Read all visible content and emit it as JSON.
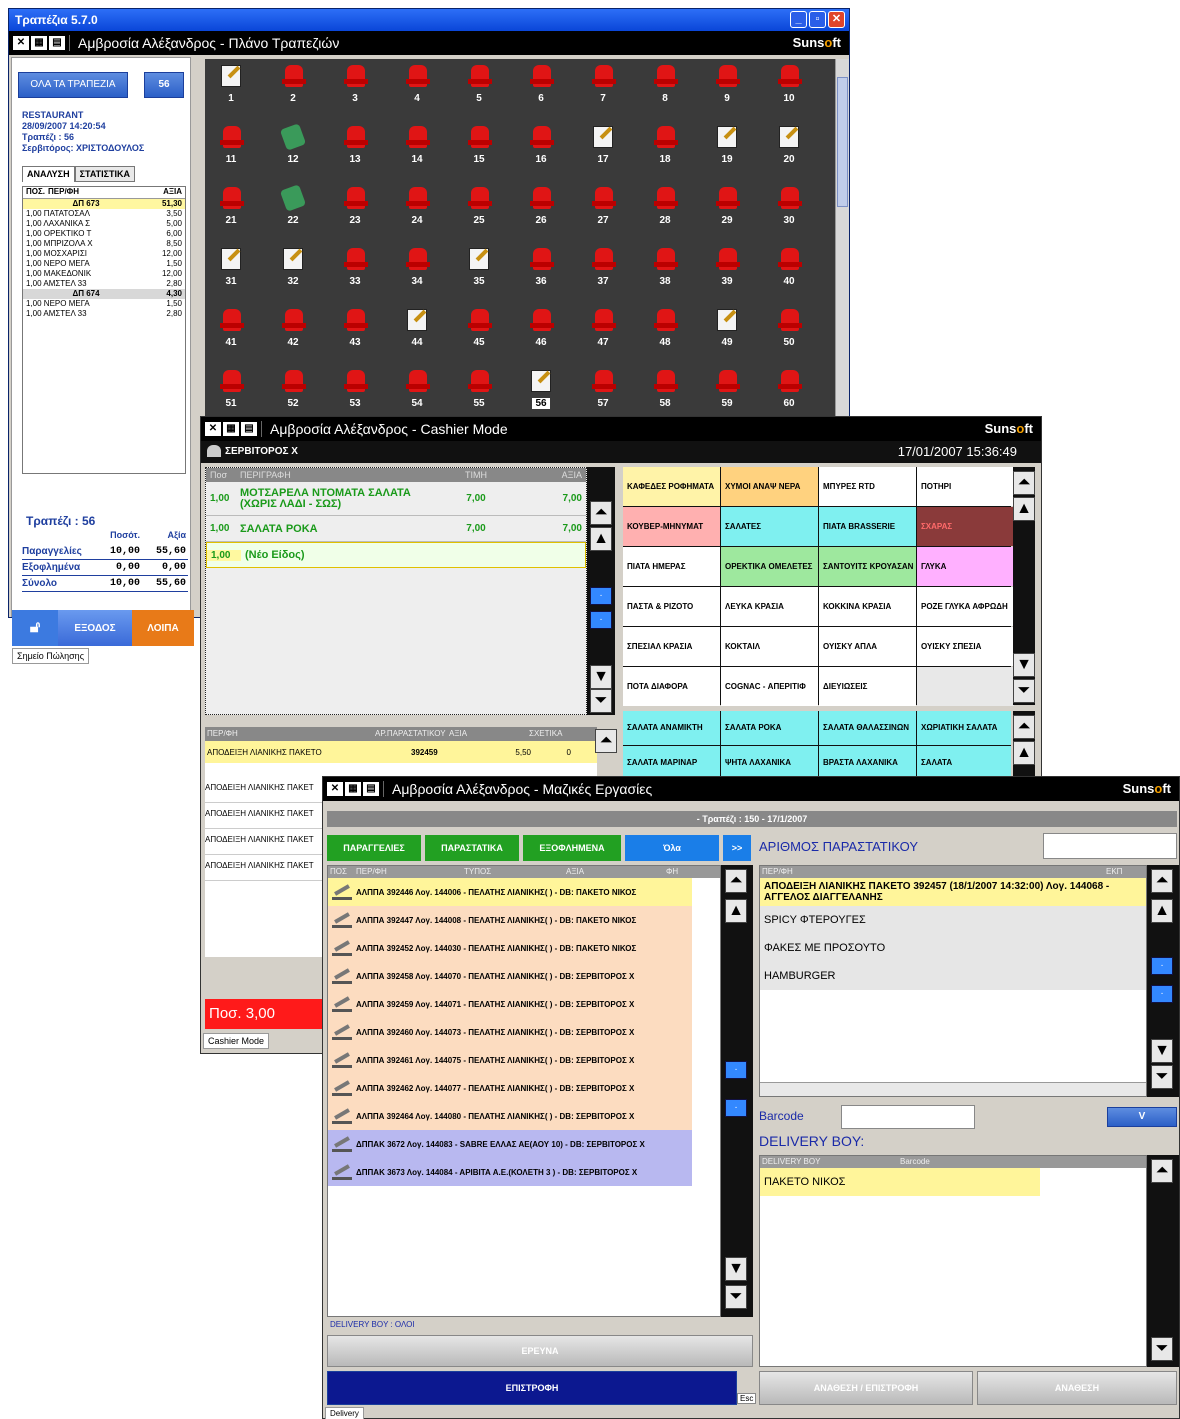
{
  "win1": {
    "titlebar": "Τραπέζια 5.7.0",
    "app_title": "Αμβροσία Αλέξανδρος - Πλάνο Τραπεζιών",
    "brand": "Sunsoft",
    "all_tables_btn": "ΟΛΑ ΤΑ ΤΡΑΠΕΖΙΑ",
    "count_btn": "56",
    "info": [
      "RESTAURANT",
      "28/09/2007   14:20:54",
      "Τραπέζι : 56",
      "Σερβιτόρος: ΧΡΙΣΤΟΔΟΥΛΟΣ"
    ],
    "tabs": [
      "ΑΝΑΛΥΣΗ",
      "ΣΤΑΤΙΣΤΙΚΑ"
    ],
    "detail_header": [
      "ΠΟΣ.",
      "ΠΕΡ/ΦΗ",
      "ΑΞΙΑ"
    ],
    "detail_rows": [
      {
        "type": "grp",
        "label": "ΔΠ 673",
        "value": "51,30"
      },
      {
        "label": "1,00 ΠΑΤΑΤΟΣΑΛ",
        "value": "3,50"
      },
      {
        "label": "1,00 ΛΑΧΑΝΙΚΑ Σ",
        "value": "5,00"
      },
      {
        "label": "1,00 ΟΡΕΚΤΙΚΟ Τ",
        "value": "6,00"
      },
      {
        "label": "1,00 ΜΠΡΙΖΟΛΑ Χ",
        "value": "8,50"
      },
      {
        "label": "1,00 ΜΟΣΧΑΡΙΣΙ",
        "value": "12,00"
      },
      {
        "label": "1,00 ΝΕΡΟ ΜΕΓΑ",
        "value": "1,50"
      },
      {
        "label": "1,00 ΜΑΚΕΔΟΝΙΚ",
        "value": "12,00"
      },
      {
        "label": "1,00 ΑΜΣΤΕΛ 33",
        "value": "2,80"
      },
      {
        "type": "grp2",
        "label": "ΔΠ 674",
        "value": "4,30"
      },
      {
        "label": "1,00 ΝΕΡΟ ΜΕΓΑ",
        "value": "1,50"
      },
      {
        "label": "1,00 ΑΜΣΤΕΛ 33",
        "value": "2,80"
      }
    ],
    "totals_title": "Τραπέζι : 56",
    "totals_header": [
      "Ποσότ.",
      "Αξία"
    ],
    "totals": [
      {
        "label": "Παραγγελίες",
        "qty": "10,00",
        "value": "55,60"
      },
      {
        "label": "Εξοφλημένα",
        "qty": "0,00",
        "value": "0,00"
      },
      {
        "label": "Σύνολο",
        "qty": "10,00",
        "value": "55,60"
      }
    ],
    "exit_btn": "ΕΞΟΔΟΣ",
    "other_btn": "ΛΟΙΠΑ",
    "status": "Σημείο Πώλησης",
    "tables": [
      {
        "n": "1",
        "s": "note"
      },
      {
        "n": "2",
        "s": "free"
      },
      {
        "n": "3",
        "s": "free"
      },
      {
        "n": "4",
        "s": "free"
      },
      {
        "n": "5",
        "s": "free"
      },
      {
        "n": "6",
        "s": "free"
      },
      {
        "n": "7",
        "s": "free"
      },
      {
        "n": "8",
        "s": "free"
      },
      {
        "n": "9",
        "s": "free"
      },
      {
        "n": "10",
        "s": "free"
      },
      {
        "n": "11",
        "s": "free"
      },
      {
        "n": "12",
        "s": "money"
      },
      {
        "n": "13",
        "s": "free"
      },
      {
        "n": "14",
        "s": "free"
      },
      {
        "n": "15",
        "s": "free"
      },
      {
        "n": "16",
        "s": "free"
      },
      {
        "n": "17",
        "s": "note"
      },
      {
        "n": "18",
        "s": "free"
      },
      {
        "n": "19",
        "s": "note"
      },
      {
        "n": "20",
        "s": "note"
      },
      {
        "n": "21",
        "s": "free"
      },
      {
        "n": "22",
        "s": "money"
      },
      {
        "n": "23",
        "s": "free"
      },
      {
        "n": "24",
        "s": "free"
      },
      {
        "n": "25",
        "s": "free"
      },
      {
        "n": "26",
        "s": "free"
      },
      {
        "n": "27",
        "s": "free"
      },
      {
        "n": "28",
        "s": "free"
      },
      {
        "n": "29",
        "s": "free"
      },
      {
        "n": "30",
        "s": "free"
      },
      {
        "n": "31",
        "s": "note"
      },
      {
        "n": "32",
        "s": "note"
      },
      {
        "n": "33",
        "s": "free"
      },
      {
        "n": "34",
        "s": "free"
      },
      {
        "n": "35",
        "s": "note"
      },
      {
        "n": "36",
        "s": "free"
      },
      {
        "n": "37",
        "s": "free"
      },
      {
        "n": "38",
        "s": "free"
      },
      {
        "n": "39",
        "s": "free"
      },
      {
        "n": "40",
        "s": "free"
      },
      {
        "n": "41",
        "s": "free"
      },
      {
        "n": "42",
        "s": "free"
      },
      {
        "n": "43",
        "s": "free"
      },
      {
        "n": "44",
        "s": "note"
      },
      {
        "n": "45",
        "s": "free"
      },
      {
        "n": "46",
        "s": "free"
      },
      {
        "n": "47",
        "s": "free"
      },
      {
        "n": "48",
        "s": "free"
      },
      {
        "n": "49",
        "s": "note"
      },
      {
        "n": "50",
        "s": "free"
      },
      {
        "n": "51",
        "s": "free"
      },
      {
        "n": "52",
        "s": "free"
      },
      {
        "n": "53",
        "s": "free"
      },
      {
        "n": "54",
        "s": "free"
      },
      {
        "n": "55",
        "s": "free"
      },
      {
        "n": "56",
        "s": "note-selected"
      },
      {
        "n": "57",
        "s": "free"
      },
      {
        "n": "58",
        "s": "free"
      },
      {
        "n": "59",
        "s": "free"
      },
      {
        "n": "60",
        "s": "free"
      }
    ]
  },
  "win2": {
    "app_title": "Αμβροσία Αλέξανδρος - Cashier Mode",
    "waiter": "ΣΕΡΒΙΤΟΡΟΣ Χ",
    "datetime": "17/01/2007   15:36:49",
    "order_header": [
      "Ποσ",
      "ΠΕΡΙΓΡΑΦΗ",
      "ΤΙΜΗ",
      "ΑΞΙΑ"
    ],
    "order_rows": [
      {
        "qty": "1,00",
        "desc": "ΜΟΤΣΑΡΕΛΑ ΝΤΟΜΑΤΑ ΣΑΛΑΤΑ (ΧΩΡΙΣ ΛΑΔΙ - ΣΩΣ)",
        "price": "7,00",
        "value": "7,00"
      },
      {
        "qty": "1,00",
        "desc": "ΣΑΛΑΤΑ ΡΟΚΑ",
        "price": "7,00",
        "value": "7,00"
      },
      {
        "qty": "1,00",
        "desc": "(Νέο Είδος)",
        "price": "",
        "value": ""
      }
    ],
    "categories": [
      {
        "label": "ΚΑΦΕΔΕΣ ΡΟΦΗΜΑΤΑ",
        "color": "#fff3a8"
      },
      {
        "label": "ΧΥΜΟΙ ΑΝΑΨ ΝΕΡΑ",
        "color": "#ffd27f"
      },
      {
        "label": "ΜΠΥΡΕΣ RTD",
        "color": "#ffffff"
      },
      {
        "label": "ΠΟΤΗΡΙ",
        "color": "#ffffff"
      },
      {
        "label": "ΚΟΥΒΕΡ-ΜΗΝΥΜΑΤ",
        "color": "#ffb0b0"
      },
      {
        "label": "ΣΑΛΑΤΕΣ",
        "color": "#7ff0f0"
      },
      {
        "label": "ΠΙΑΤΑ BRASSERIE",
        "color": "#7ff0f0"
      },
      {
        "label": "ΣΧΑΡΑΣ",
        "color": "#8a3a3a"
      },
      {
        "label": "ΠΙΑΤΑ ΗΜΕΡΑΣ",
        "color": "#ffffff"
      },
      {
        "label": "ΟΡΕΚΤΙΚΑ ΟΜΕΛΕΤΕΣ",
        "color": "#9ee89e"
      },
      {
        "label": "ΣΑΝΤΟΥΙΤΣ ΚΡΟΥΑΣΑΝ",
        "color": "#9ee89e"
      },
      {
        "label": "ΓΛΥΚΑ",
        "color": "#ffb0ff"
      },
      {
        "label": "ΠΑΣΤΑ & ΡΙΖΟΤΟ",
        "color": "#ffffff"
      },
      {
        "label": "ΛΕΥΚΑ ΚΡΑΣΙΑ",
        "color": "#ffffff"
      },
      {
        "label": "ΚΟΚΚΙΝΑ ΚΡΑΣΙΑ",
        "color": "#ffffff"
      },
      {
        "label": "ΡΟΖΕ ΓΛΥΚΑ ΑΦΡΩΔΗ",
        "color": "#ffffff"
      },
      {
        "label": "ΣΠΕΣΙΑΛ ΚΡΑΣΙΑ",
        "color": "#ffffff"
      },
      {
        "label": "ΚΟΚΤΑΙΛ",
        "color": "#ffffff"
      },
      {
        "label": "ΟΥΙΣΚΥ ΑΠΛΑ",
        "color": "#ffffff"
      },
      {
        "label": "ΟΥΙΣΚΥ ΣΠΕΣΙΑ",
        "color": "#ffffff"
      },
      {
        "label": "ΠΟΤΑ ΔΙΑΦΟΡΑ",
        "color": "#ffffff"
      },
      {
        "label": "COGNAC - ΑΠΕΡΙΤΙΦ",
        "color": "#ffffff"
      },
      {
        "label": "ΔΙΕΥΙΩΣΕΙΣ",
        "color": "#ffffff"
      },
      {
        "label": "",
        "color": "#e8e8e8"
      }
    ],
    "products": [
      {
        "label": "ΣΑΛΑΤΑ ΑΝΑΜΙΚΤΗ"
      },
      {
        "label": "ΣΑΛΑΤΑ ΡΟΚΑ"
      },
      {
        "label": "ΣΑΛΑΤΑ ΘΑΛΑΣΣΙΝΩΝ"
      },
      {
        "label": "ΧΩΡΙΑΤΙΚΗ ΣΑΛΑΤΑ"
      },
      {
        "label": "ΣΑΛΑΤΑ ΜΑΡΙΝΑΡ"
      },
      {
        "label": "ΨΗΤΑ ΛΑΧΑΝΙΚΑ"
      },
      {
        "label": "ΒΡΑΣΤΑ ΛΑΧΑΝΙΚΑ"
      },
      {
        "label": "ΣΑΛΑΤΑ"
      }
    ],
    "doc_header": [
      "ΠΕΡ/ΦΗ",
      "ΑΡ.ΠΑΡΑΣΤΑΤΙΚΟΥ",
      "ΑΞΙΑ",
      "ΣΧΕΤΙΚΑ"
    ],
    "doc_row": {
      "desc": "ΑΠΟΔΕΙΞΗ ΛΙΑΝΙΚΗΣ ΠΑΚΕΤΟ",
      "num": "392459",
      "value": "5,50",
      "rel": "0"
    },
    "doc_rest": [
      "ΑΠΟΔΕΙΞΗ ΛΙΑΝΙΚΗΣ ΠΑΚΕΤ",
      "ΑΠΟΔΕΙΞΗ ΛΙΑΝΙΚΗΣ ΠΑΚΕΤ",
      "ΑΠΟΔΕΙΞΗ ΛΙΑΝΙΚΗΣ ΠΑΚΕΤ",
      "ΑΠΟΔΕΙΞΗ ΛΙΑΝΙΚΗΣ ΠΑΚΕΤ"
    ],
    "qty_label": "Ποσ.  3,00",
    "status": "Cashier Mode"
  },
  "win3": {
    "app_title": "Αμβροσία Αλέξανδρος - Μαζικές Εργασίες",
    "info": "- Τραπέζι : 150  -  17/1/2007",
    "tabs": [
      {
        "label": "ΠΑΡΑΓΓΕΛΙΕΣ",
        "color": "#22a022"
      },
      {
        "label": "ΠΑΡΑΣΤΑΤΙΚΑ",
        "color": "#22a022"
      },
      {
        "label": "ΕΞΟΦΛΗΜΕΝΑ",
        "color": "#22a022"
      },
      {
        "label": "Όλα",
        "color": "#1a7ee8"
      }
    ],
    "more_btn": ">>",
    "list_header": [
      "ΠΟΣ",
      "ΠΕΡ/ΦΗ",
      "ΤΥΠΟΣ",
      "ΑΞΙΑ",
      "ΦΗ"
    ],
    "list_items": [
      {
        "text": "ΑΛΠΠΑ 392446 Λογ. 144006 - ΠΕΛΑΤΗΣ ΛΙΑΝΙΚΗΣ( ) - DB: ΠΑΚΕΤΟ ΝΙΚΟΣ",
        "color": "#fff59a"
      },
      {
        "text": "ΑΛΠΠΑ 392447 Λογ. 144008 - ΠΕΛΑΤΗΣ ΛΙΑΝΙΚΗΣ( ) - DB: ΠΑΚΕΤΟ ΝΙΚΟΣ",
        "color": "#fcdcc0"
      },
      {
        "text": "ΑΛΠΠΑ 392452 Λογ. 144030 - ΠΕΛΑΤΗΣ ΛΙΑΝΙΚΗΣ( ) - DB: ΠΑΚΕΤΟ ΝΙΚΟΣ",
        "color": "#fcdcc0"
      },
      {
        "text": "ΑΛΠΠΑ 392458 Λογ. 144070 - ΠΕΛΑΤΗΣ ΛΙΑΝΙΚΗΣ( ) - DB: ΣΕΡΒΙΤΟΡΟΣ Χ",
        "color": "#fcdcc0"
      },
      {
        "text": "ΑΛΠΠΑ 392459 Λογ. 144071 - ΠΕΛΑΤΗΣ ΛΙΑΝΙΚΗΣ( ) - DB: ΣΕΡΒΙΤΟΡΟΣ Χ",
        "color": "#fcdcc0"
      },
      {
        "text": "ΑΛΠΠΑ 392460 Λογ. 144073 - ΠΕΛΑΤΗΣ ΛΙΑΝΙΚΗΣ( ) - DB: ΣΕΡΒΙΤΟΡΟΣ Χ",
        "color": "#fcdcc0"
      },
      {
        "text": "ΑΛΠΠΑ 392461 Λογ. 144075 - ΠΕΛΑΤΗΣ ΛΙΑΝΙΚΗΣ( ) - DB: ΣΕΡΒΙΤΟΡΟΣ Χ",
        "color": "#fcdcc0"
      },
      {
        "text": "ΑΛΠΠΑ 392462 Λογ. 144077 - ΠΕΛΑΤΗΣ ΛΙΑΝΙΚΗΣ( ) - DB: ΣΕΡΒΙΤΟΡΟΣ Χ",
        "color": "#fcdcc0"
      },
      {
        "text": "ΑΛΠΠΑ 392464 Λογ. 144080 - ΠΕΛΑΤΗΣ ΛΙΑΝΙΚΗΣ( ) - DB: ΣΕΡΒΙΤΟΡΟΣ Χ",
        "color": "#fcdcc0"
      },
      {
        "text": "ΔΠΠΑΚ 3672 Λογ. 144083 - SABRE ΕΛΛΑΣ ΑΕ(ΑΟΥ 10) - DB: ΣΕΡΒΙΤΟΡΟΣ Χ",
        "color": "#b8b8f0"
      },
      {
        "text": "ΔΠΠΑΚ 3673 Λογ. 144084 - ΑΡΙΒΙΤΑ Α.Ε.(ΚΟΛΕΤΗ 3 ) - DB: ΣΕΡΒΙΤΟΡΟΣ Χ",
        "color": "#b8b8f0"
      }
    ],
    "delivery_filter": "DELIVERY BOY : ΟΛΟΙ",
    "search_btn": "ΕΡΕΥΝΑ",
    "return_btn": "ΕΠΙΣΤΡΟΦΗ",
    "esc_label": "Esc",
    "doc_number_label": "ΑΡΙΘΜΟΣ ΠΑΡΑΣΤΑΤΙΚΟΥ",
    "detail_header": [
      "ΠΕΡ/ΦΗ",
      "ΕΚΠ"
    ],
    "detail_title": "ΑΠΟΔΕΙΞΗ ΛΙΑΝΙΚΗΣ ΠΑΚΕΤΟ 392457 (18/1/2007 14:32:00) Λογ. 144068 - ΑΓΓΕΛΟΣ ΔΙΑΓΓΕΛΑΝΗΣ",
    "detail_items": [
      "SPICY ΦΤΕΡΟΥΓΕΣ",
      "ΦΑΚΕΣ ΜΕ ΠΡΟΣΟΥΤΟ",
      "HAMBURGER"
    ],
    "barcode_label": "Barcode",
    "v_btn": "V",
    "delivery_title": "DELIVERY BOY:",
    "delivery_header": [
      "DELIVERY BOY",
      "Barcode"
    ],
    "delivery_item": "ΠΑΚΕΤΟ ΝΙΚΟΣ",
    "assign_return_btn": "ΑΝΑΘΕΣΗ / ΕΠΙΣΤΡΟΦΗ",
    "assign_btn": "ΑΝΑΘΕΣΗ",
    "status": "Delivery"
  },
  "colors": {
    "accent": "#1a2aa8",
    "danger": "#ff1a1a",
    "brand_orange": "#f5a000"
  }
}
